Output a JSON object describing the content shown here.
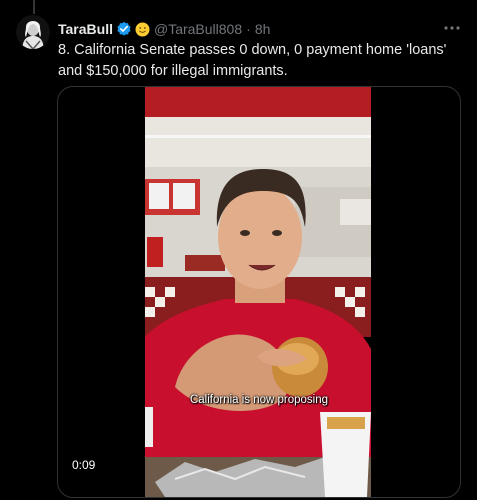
{
  "tweet": {
    "author_name": "TaraBull",
    "handle": "@TaraBull808",
    "separator": "·",
    "time": "8h",
    "text": "8. California Senate passes 0 down, 0 payment home 'loans' and $150,000 for illegal immigrants.",
    "verified_icon": "verified-badge-icon",
    "emoji_icon": "smiley-emoji-icon",
    "more_icon": "more-options-icon"
  },
  "media": {
    "caption": "California is now proposing",
    "timecode": "0:09"
  },
  "colors": {
    "background": "#000000",
    "text": "#e7e9ea",
    "muted": "#71767b",
    "verified_blue": "#1d9bf0",
    "shirt_red": "#c8102e"
  }
}
